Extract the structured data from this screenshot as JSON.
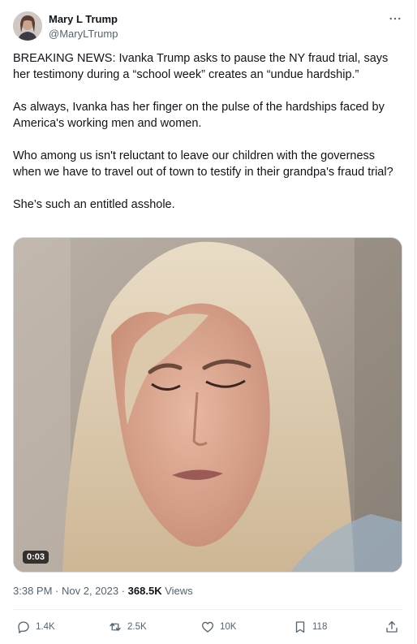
{
  "author": {
    "name": "Mary L Trump",
    "handle": "@MaryLTrump",
    "more_icon": "more-dots-icon"
  },
  "tweet": {
    "paragraphs": [
      "BREAKING NEWS: Ivanka Trump asks to pause the NY fraud trial, says her testimony during a “school week” creates an “undue hardship.”",
      "As always, Ivanka has her finger on the pulse of the hardships faced by America's working men and women.",
      "Who among us isn't reluctant to leave our children with the governess when we have to travel out of town to testify in their grandpa's fraud trial?",
      "She’s such an entitled asshole."
    ]
  },
  "media": {
    "duration": "0:03"
  },
  "meta": {
    "time": "3:38 PM",
    "separator": " · ",
    "date": "Nov 2, 2023",
    "views_count": "368.5K",
    "views_label": " Views"
  },
  "actions": {
    "reply_count": "1.4K",
    "retweet_count": "2.5K",
    "like_count": "10K",
    "bookmark_count": "118"
  },
  "colors": {
    "text_primary": "#0f1419",
    "text_secondary": "#536471",
    "border": "#cfd9de"
  }
}
